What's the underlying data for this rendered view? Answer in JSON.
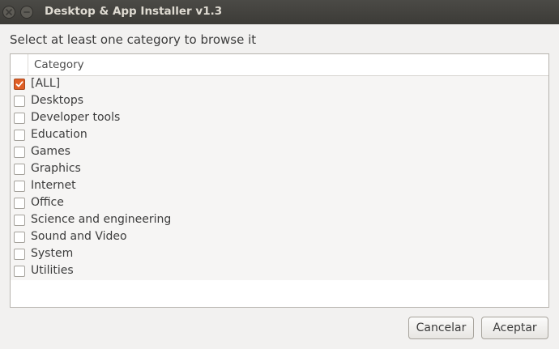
{
  "window": {
    "title": "Desktop & App Installer v1.3"
  },
  "prompt": "Select at least one category to browse it",
  "table": {
    "column_header": "Category",
    "rows": [
      {
        "label": "[ALL]",
        "checked": true
      },
      {
        "label": "Desktops",
        "checked": false
      },
      {
        "label": "Developer tools",
        "checked": false
      },
      {
        "label": "Education",
        "checked": false
      },
      {
        "label": "Games",
        "checked": false
      },
      {
        "label": "Graphics",
        "checked": false
      },
      {
        "label": "Internet",
        "checked": false
      },
      {
        "label": "Office",
        "checked": false
      },
      {
        "label": "Science and engineering",
        "checked": false
      },
      {
        "label": "Sound and Video",
        "checked": false
      },
      {
        "label": "System",
        "checked": false
      },
      {
        "label": "Utilities",
        "checked": false
      }
    ]
  },
  "buttons": {
    "cancel_label": "Cancelar",
    "accept_label": "Aceptar"
  },
  "colors": {
    "titlebar": "#3c3b37",
    "checkbox_accent": "#e05e24",
    "window_bg": "#f2f1f0"
  }
}
